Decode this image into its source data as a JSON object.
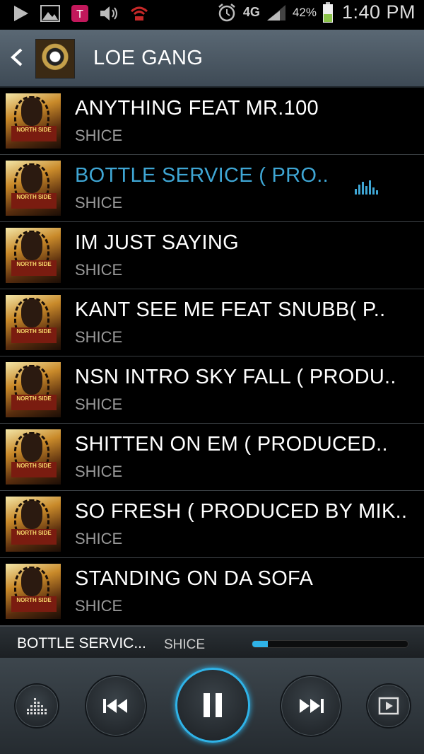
{
  "status_bar": {
    "time": "1:40 PM",
    "battery_percent": "42%",
    "network": "4G"
  },
  "header": {
    "title": "LOE GANG"
  },
  "tracks": [
    {
      "title": "ANYTHING FEAT MR.100",
      "artist": "SHICE"
    },
    {
      "title": "BOTTLE SERVICE ( PRO..",
      "artist": "SHICE",
      "playing": true
    },
    {
      "title": "IM JUST SAYING",
      "artist": "SHICE"
    },
    {
      "title": "KANT SEE ME  FEAT SNUBB( P..",
      "artist": "SHICE"
    },
    {
      "title": "NSN INTRO SKY FALL  ( PRODU..",
      "artist": "SHICE"
    },
    {
      "title": "SHITTEN ON EM  ( PRODUCED..",
      "artist": "SHICE"
    },
    {
      "title": "SO FRESH ( PRODUCED BY MIK..",
      "artist": "SHICE"
    },
    {
      "title": "STANDING ON DA SOFA",
      "artist": "SHICE"
    }
  ],
  "now_playing": {
    "title": "BOTTLE SERVIC...",
    "artist": "SHICE",
    "progress": 0.1
  },
  "colors": {
    "accent": "#2fb3e8",
    "active_title": "#3fa6d4"
  }
}
